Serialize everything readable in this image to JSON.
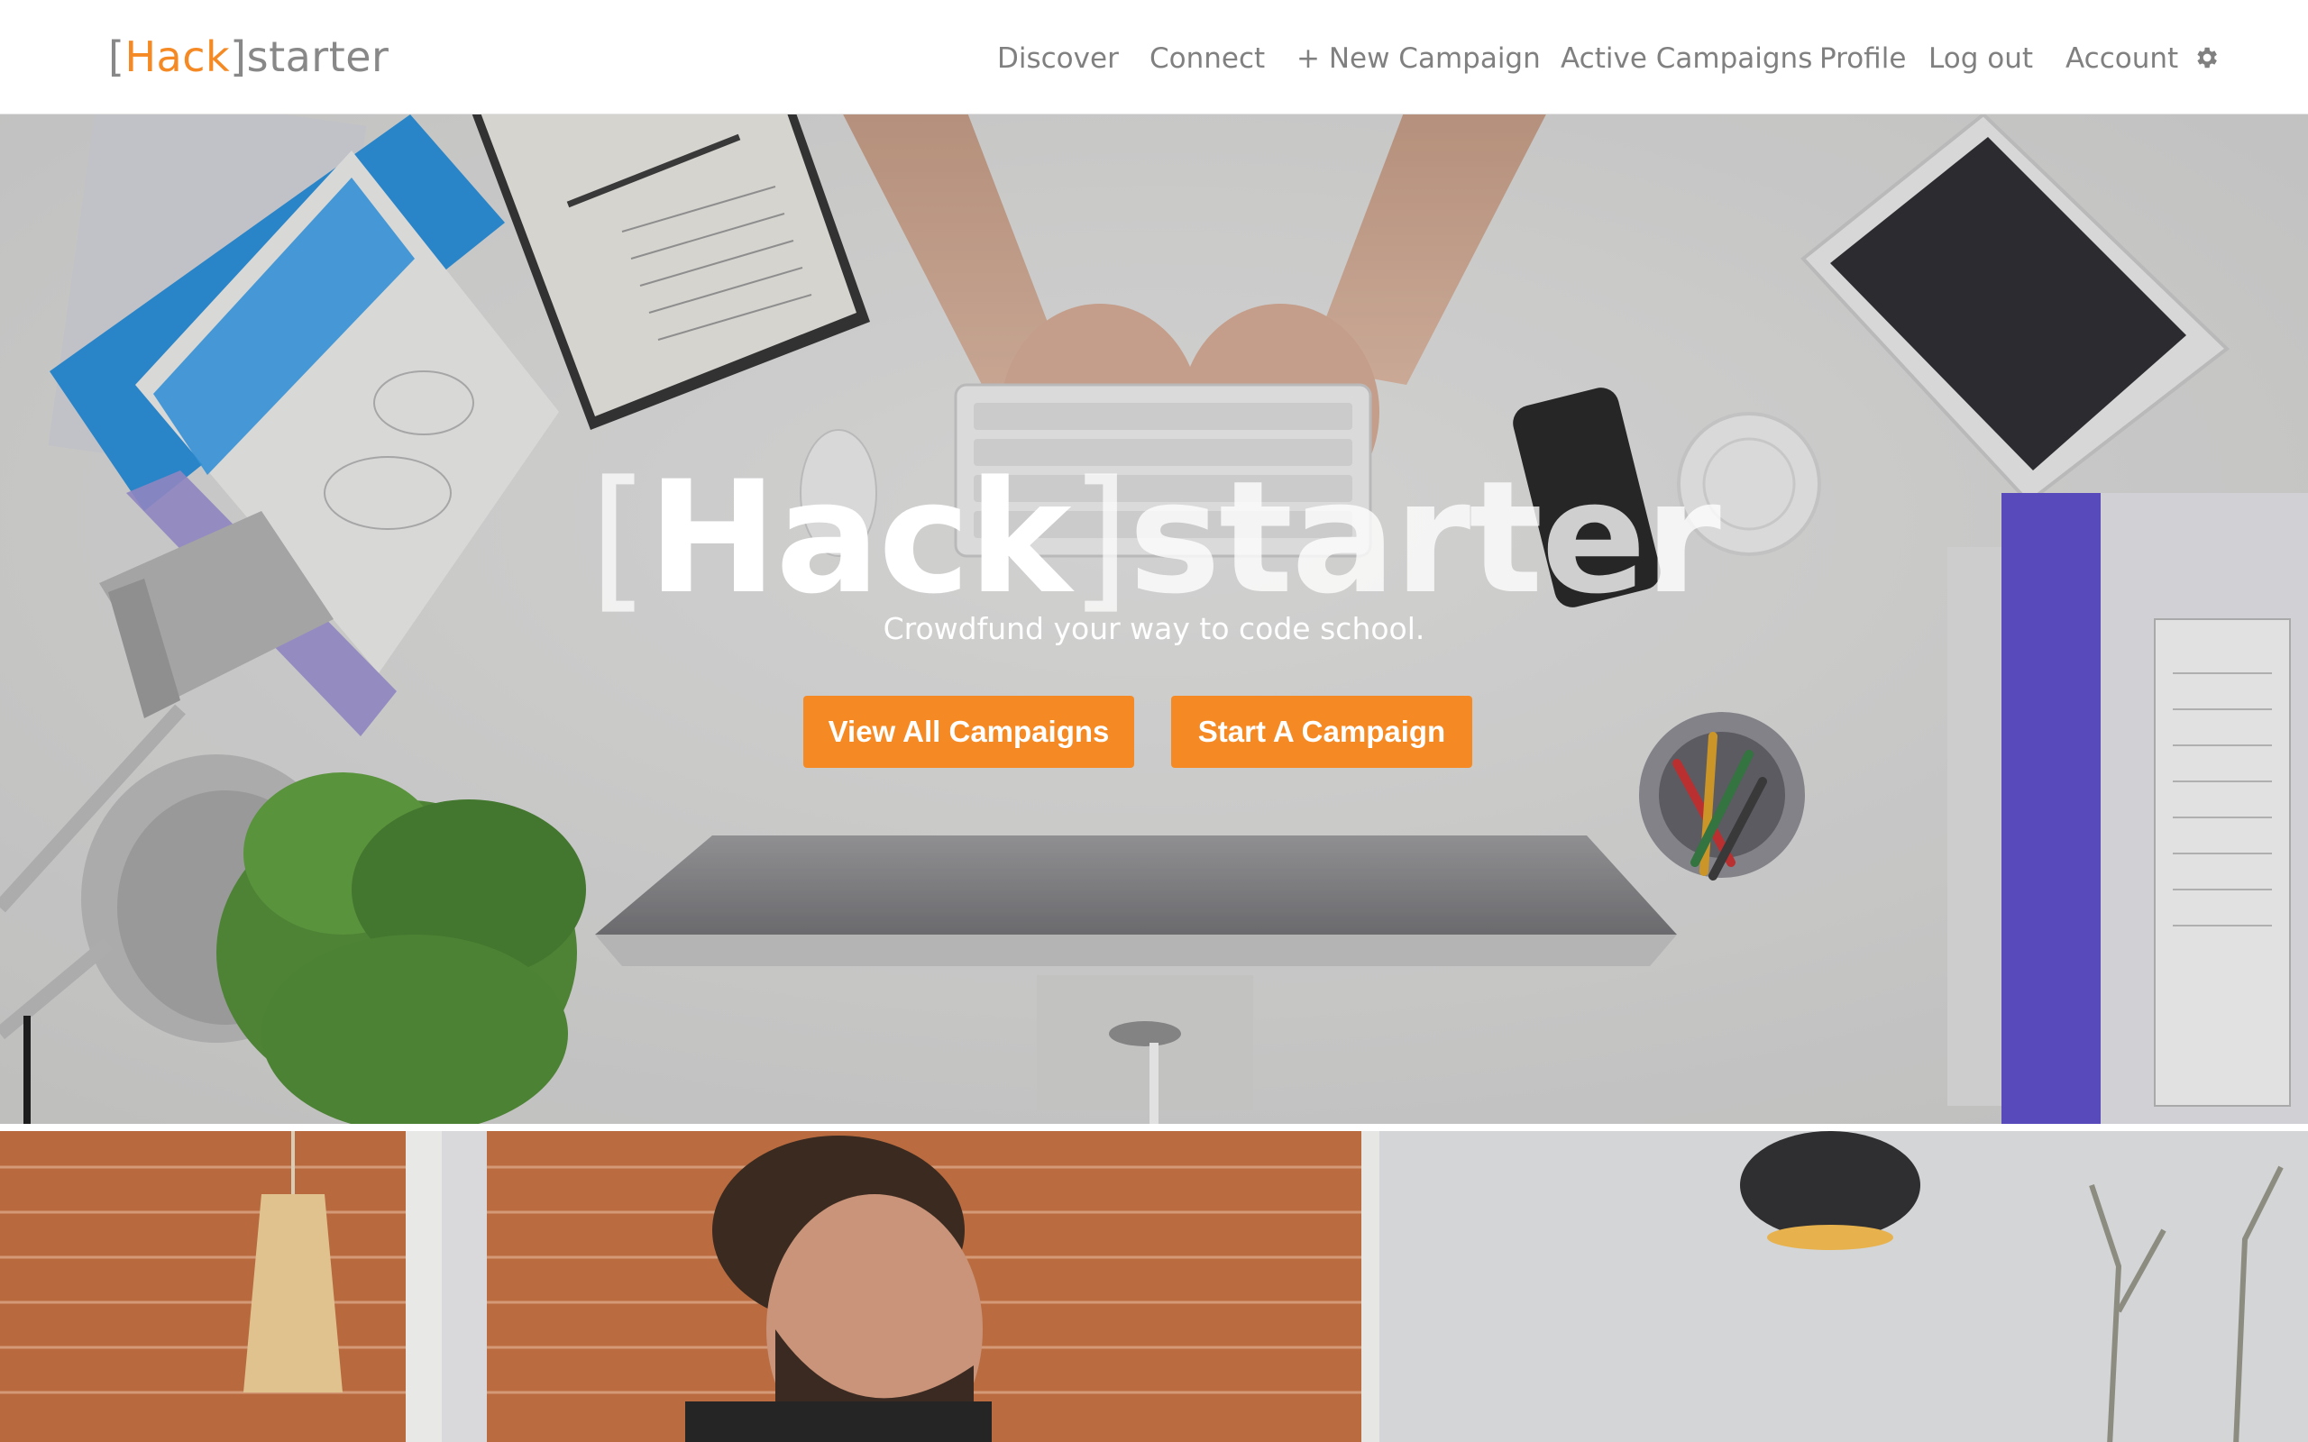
{
  "navbar": {
    "brand": {
      "open_bracket": "[",
      "accent": "Hack",
      "rest": "]starter"
    },
    "links": {
      "discover": "Discover",
      "connect": "Connect",
      "new_campaign": "+ New Campaign",
      "active_campaigns": "Active Campaigns",
      "profile": "Profile",
      "logout": "Log out",
      "account": "Account"
    },
    "account_icon": "gear-icon"
  },
  "hero": {
    "title": {
      "open_bracket": "[",
      "hack": "Hack",
      "close_bracket": "]",
      "starter": "starter"
    },
    "tagline": "Crowdfund your way to code school.",
    "buttons": {
      "view_all": "View All Campaigns",
      "start": "Start A Campaign"
    },
    "background_image": "overhead desk workspace photo"
  },
  "second_panel": {
    "background_image": "man at brick-walled cafe photo"
  },
  "colors": {
    "accent": "#f58a25",
    "nav_text": "#808080",
    "navbar_bg": "#ffffff"
  }
}
